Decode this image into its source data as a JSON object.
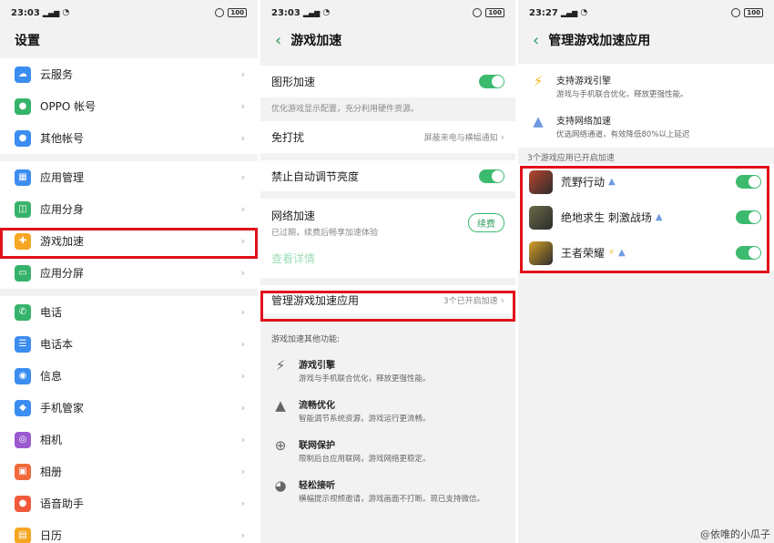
{
  "panel1": {
    "status": {
      "time": "23:03",
      "battery": "100"
    },
    "title": "设置",
    "groups": [
      [
        {
          "label": "云服务",
          "icon": "cloud-icon",
          "color": "#3b8df0"
        },
        {
          "label": "OPPO 帐号",
          "icon": "person-icon",
          "color": "#36b36a"
        },
        {
          "label": "其他帐号",
          "icon": "person-icon",
          "color": "#3b8df0"
        }
      ],
      [
        {
          "label": "应用管理",
          "icon": "grid-icon",
          "color": "#3b8df0"
        },
        {
          "label": "应用分身",
          "icon": "clone-icon",
          "color": "#36b36a"
        },
        {
          "label": "游戏加速",
          "icon": "gamepad-icon",
          "color": "#f5a623"
        },
        {
          "label": "应用分屏",
          "icon": "split-screen-icon",
          "color": "#36b36a"
        }
      ],
      [
        {
          "label": "电话",
          "icon": "phone-icon",
          "color": "#36b36a"
        },
        {
          "label": "电话本",
          "icon": "contacts-icon",
          "color": "#3b8df0"
        },
        {
          "label": "信息",
          "icon": "message-icon",
          "color": "#3b8df0"
        },
        {
          "label": "手机管家",
          "icon": "shield-icon",
          "color": "#3b8df0"
        },
        {
          "label": "相机",
          "icon": "camera-icon",
          "color": "#9b59d0"
        },
        {
          "label": "相册",
          "icon": "photo-icon",
          "color": "#f06a3b"
        },
        {
          "label": "语音助手",
          "icon": "microphone-icon",
          "color": "#f05a3b"
        },
        {
          "label": "日历",
          "icon": "calendar-icon",
          "color": "#f5a623"
        }
      ]
    ]
  },
  "panel2": {
    "status": {
      "time": "23:03",
      "battery": "100"
    },
    "title": "游戏加速",
    "graphics": {
      "label": "图形加速",
      "desc": "优化游戏显示配置，充分利用硬件资源。"
    },
    "no_disturb": {
      "label": "免打扰",
      "value": "屏蔽来电与横幅通知"
    },
    "brightness": {
      "label": "禁止自动调节亮度"
    },
    "network": {
      "label": "网络加速",
      "desc": "已过期，续费后畅享加速体验",
      "button": "续费",
      "details": "查看详情"
    },
    "manage": {
      "label": "管理游戏加速应用",
      "value": "3个已开启加速"
    },
    "other_title": "游戏加速其他功能:",
    "features": [
      {
        "title": "游戏引擎",
        "desc": "游戏与手机联合优化，释放更强性能。",
        "icon": "lightning-icon"
      },
      {
        "title": "流畅优化",
        "desc": "智能调节系统资源，游戏运行更流畅。",
        "icon": "rocket-icon"
      },
      {
        "title": "联网保护",
        "desc": "限制后台应用联网，游戏网络更稳定。",
        "icon": "globe-icon"
      },
      {
        "title": "轻松接听",
        "desc": "横幅提示视频邀请，游戏画面不打断。现已支持微信。",
        "icon": "chat-icon"
      }
    ]
  },
  "panel3": {
    "status": {
      "time": "23:27",
      "battery": "100"
    },
    "title": "管理游戏加速应用",
    "engine": {
      "title": "支持游戏引擎",
      "desc": "游戏与手机联合优化，释放更强性能。"
    },
    "net": {
      "title": "支持网络加速",
      "desc": "优选网络通道，有效降低80%以上延迟"
    },
    "count": "3个游戏应用已开启加速",
    "games": [
      {
        "name": "荒野行动",
        "tags": [
          "rocket-icon"
        ],
        "icon_color": "#b8462f"
      },
      {
        "name": "绝地求生 刺激战场",
        "tags": [
          "rocket-icon"
        ],
        "icon_color": "#6b6a48"
      },
      {
        "name": "王者荣耀",
        "tags": [
          "lightning-icon",
          "rocket-icon"
        ],
        "icon_color": "#d4a12a"
      }
    ]
  },
  "watermark": "@依唯的小瓜子",
  "colors": {
    "accent": "#3cba6e",
    "highlight": "#e0101a"
  }
}
